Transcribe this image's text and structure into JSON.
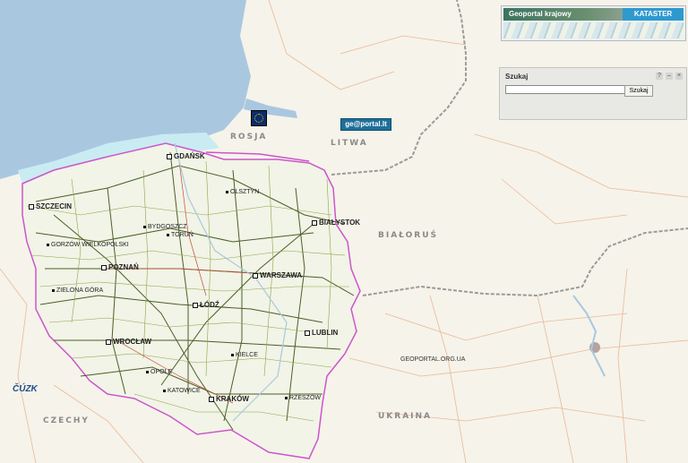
{
  "map": {
    "country_labels": {
      "rosja": "ROSJA",
      "litwa": "LITWA",
      "bialorus": "BIAŁORUŚ",
      "czechy": "CZECHY",
      "ukraina": "UKRAINA"
    },
    "cities": {
      "gdansk": "GDAŃSK",
      "szczecin": "SZCZECIN",
      "bydgoszcz": "BYDGOSZCZ",
      "torun": "TORUŃ",
      "olsztyn": "OLSZTYN",
      "bialystok": "BIAŁYSTOK",
      "gorzow": "GORZÓW WIELKOPOLSKI",
      "poznan": "POZNAŃ",
      "warszawa": "WARSZAWA",
      "zielona_gora": "ZIELONA GÓRA",
      "lodz": "ŁÓDŹ",
      "lublin": "LUBLIN",
      "wroclaw": "WROCŁAW",
      "kielce": "KIELCE",
      "krakow": "KRAKÓW",
      "rzeszow": "RZESZÓW",
      "opole": "OPOLE",
      "katowice": "KATOWICE"
    },
    "colors": {
      "sea": "#a9c8e0",
      "land": "#f6f3ea",
      "poland": "#f3f5ec",
      "border": "#cc55cc",
      "road_major": "#556b2f",
      "road_minor": "#e0a070"
    }
  },
  "banner": {
    "geoportal_label": "Geoportal krajowy",
    "kataster_label": "KATASTER"
  },
  "search": {
    "title": "Szukaj",
    "help": "?",
    "minimize": "–",
    "close": "×",
    "input_value": "",
    "button_label": "Szukaj"
  },
  "logos": {
    "geoportal_lt": "ge@portal.lt",
    "cuzk": "ČÚZK",
    "geoportal_ua": "GEOPORTAL.ORG.UA"
  }
}
